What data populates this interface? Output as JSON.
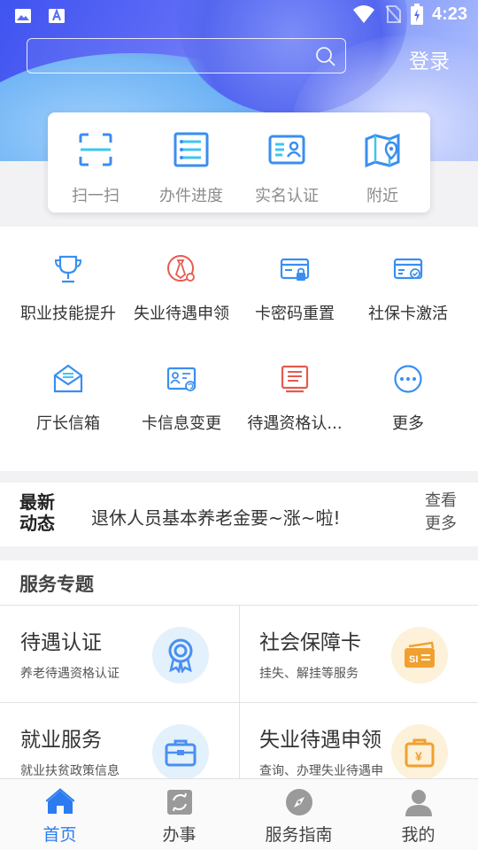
{
  "status_bar": {
    "time": "4:23"
  },
  "header": {
    "search": {
      "placeholder": "",
      "value": ""
    },
    "login_label": "登录"
  },
  "quick_actions": [
    {
      "label": "扫一扫",
      "icon": "scan-icon"
    },
    {
      "label": "办件进度",
      "icon": "progress-list-icon"
    },
    {
      "label": "实名认证",
      "icon": "id-card-icon"
    },
    {
      "label": "附近",
      "icon": "map-pin-icon"
    }
  ],
  "grid_items": [
    {
      "label": "职业技能提升",
      "icon": "trophy-icon"
    },
    {
      "label": "失业待遇申领",
      "icon": "tie-icon"
    },
    {
      "label": "卡密码重置",
      "icon": "card-lock-icon"
    },
    {
      "label": "社保卡激活",
      "icon": "card-check-icon"
    },
    {
      "label": "厅长信箱",
      "icon": "mail-icon"
    },
    {
      "label": "卡信息变更",
      "icon": "card-refresh-icon"
    },
    {
      "label": "待遇资格认...",
      "icon": "document-list-icon"
    },
    {
      "label": "更多",
      "icon": "more-icon"
    }
  ],
  "news": {
    "logo_line1": "最新",
    "logo_line2": "动态",
    "headline": "退休人员基本养老金要~涨~啦!",
    "more_line1": "查看",
    "more_line2": "更多"
  },
  "services": {
    "title": "服务专题",
    "cards": [
      {
        "title": "待遇认证",
        "subtitle": "养老待遇资格认证",
        "icon": "award-ribbon-icon",
        "color": "#4a8ff0",
        "bg": "#e3f1fc"
      },
      {
        "title": "社会保障卡",
        "subtitle": "挂失、解挂等服务",
        "icon": "si-card-icon",
        "color": "#f0a030",
        "bg": "#fdf1d9"
      },
      {
        "title": "就业服务",
        "subtitle": "就业扶贫政策信息",
        "icon": "briefcase-icon",
        "color": "#4a8ff0",
        "bg": "#e3f1fc"
      },
      {
        "title": "失业待遇申领",
        "subtitle": "查询、办理失业待遇申",
        "icon": "yuan-bag-icon",
        "color": "#f0a030",
        "bg": "#fdf1d9"
      }
    ]
  },
  "tabbar": [
    {
      "label": "首页",
      "icon": "home-icon",
      "active": true
    },
    {
      "label": "办事",
      "icon": "services-icon",
      "active": false
    },
    {
      "label": "服务指南",
      "icon": "compass-icon",
      "active": false
    },
    {
      "label": "我的",
      "icon": "user-icon",
      "active": false
    }
  ],
  "colors": {
    "accent": "#2c7cf0",
    "icon_blue": "#3a8ef0",
    "icon_red": "#e55a4e",
    "icon_orange": "#f0a030"
  }
}
